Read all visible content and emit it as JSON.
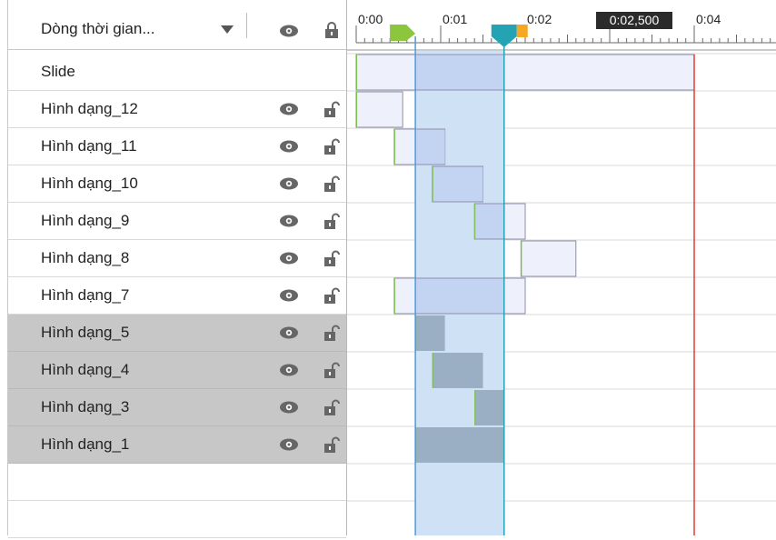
{
  "header": {
    "title": "Dòng thời gian...",
    "dropdown_icon": "triangle-down-icon",
    "eye_icon": "eye-icon",
    "lock_icon": "lock-icon"
  },
  "rows": [
    {
      "label": "Slide",
      "selected": false,
      "icons": false
    },
    {
      "label": "Hình dạng_12",
      "selected": false,
      "icons": true
    },
    {
      "label": "Hình dạng_11",
      "selected": false,
      "icons": true
    },
    {
      "label": "Hình dạng_10",
      "selected": false,
      "icons": true
    },
    {
      "label": "Hình dạng_9",
      "selected": false,
      "icons": true
    },
    {
      "label": "Hình dạng_8",
      "selected": false,
      "icons": true
    },
    {
      "label": "Hình dạng_7",
      "selected": false,
      "icons": true
    },
    {
      "label": "Hình dạng_5",
      "selected": true,
      "icons": true
    },
    {
      "label": "Hình dạng_4",
      "selected": true,
      "icons": true
    },
    {
      "label": "Hình dạng_3",
      "selected": true,
      "icons": true
    },
    {
      "label": "Hình dạng_1",
      "selected": true,
      "icons": true
    }
  ],
  "ruler": {
    "labels": [
      "0:00",
      "0:01",
      "0:02",
      "0:04",
      "0:"
    ],
    "playhead_time": "0:02,500"
  },
  "timeline_bars": [
    {
      "row": 0,
      "start": 0.0,
      "end": 4.0,
      "selected": false
    },
    {
      "row": 1,
      "start": 0.0,
      "end": 0.55,
      "selected": false
    },
    {
      "row": 2,
      "start": 0.45,
      "end": 1.05,
      "selected": false
    },
    {
      "row": 3,
      "start": 0.9,
      "end": 1.5,
      "selected": false
    },
    {
      "row": 4,
      "start": 1.4,
      "end": 2.0,
      "selected": false
    },
    {
      "row": 5,
      "start": 1.95,
      "end": 2.6,
      "selected": false
    },
    {
      "row": 6,
      "start": 0.45,
      "end": 2.0,
      "selected": false
    },
    {
      "row": 7,
      "start": 0.7,
      "end": 1.05,
      "selected": true
    },
    {
      "row": 8,
      "start": 0.9,
      "end": 1.5,
      "selected": true
    },
    {
      "row": 9,
      "start": 1.4,
      "end": 1.75,
      "selected": true
    },
    {
      "row": 10,
      "start": 0.7,
      "end": 1.75,
      "selected": true
    }
  ],
  "selection_range": {
    "start": 0.7,
    "end": 1.75
  },
  "end_marker_time": 4.0,
  "colors": {
    "row_selected": "#c7c7c7",
    "selection_band": "#cfe2f5",
    "bar_normal": "#eef1fb",
    "bar_on_band": "#c2d4f2",
    "bar_selected": "#9aafc4",
    "playhead": "#23a3b4",
    "start_marker": "#8cc63f",
    "orange_marker": "#f7a823",
    "end_line": "#e53935",
    "blue_line": "#4a9be0"
  }
}
